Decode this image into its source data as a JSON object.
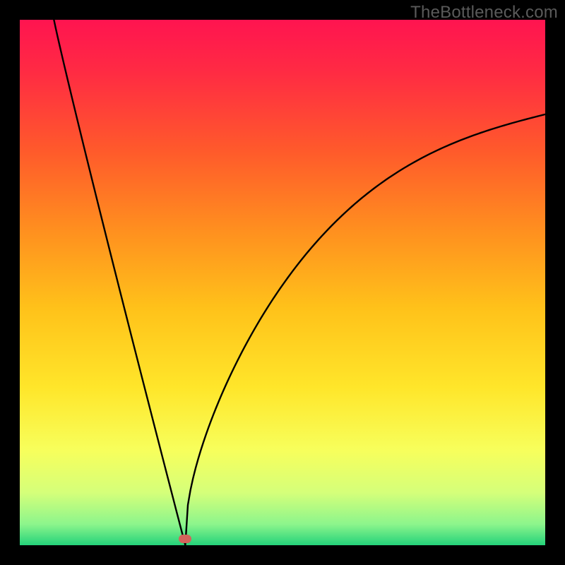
{
  "watermark": "TheBottleneck.com",
  "chart_data": {
    "type": "line",
    "title": "",
    "xlabel": "",
    "ylabel": "",
    "xlim_fraction": [
      0,
      1
    ],
    "ylim_fraction": [
      0,
      1
    ],
    "gradient_stops": [
      {
        "offset": 0.0,
        "color": "#ff1450"
      },
      {
        "offset": 0.1,
        "color": "#ff2b43"
      },
      {
        "offset": 0.25,
        "color": "#ff5a2b"
      },
      {
        "offset": 0.4,
        "color": "#ff8f1f"
      },
      {
        "offset": 0.55,
        "color": "#ffc21a"
      },
      {
        "offset": 0.7,
        "color": "#ffe62a"
      },
      {
        "offset": 0.82,
        "color": "#f7ff5c"
      },
      {
        "offset": 0.9,
        "color": "#d5ff7a"
      },
      {
        "offset": 0.96,
        "color": "#8cf58c"
      },
      {
        "offset": 1.0,
        "color": "#24d27a"
      }
    ],
    "series": [
      {
        "name": "bottleneck-curve",
        "note": "y ≈ |x - minimum.x| shaped curve; left branch very steep, right branch rises asymptotically toward ~0.82",
        "minimum_x_fraction": 0.315,
        "minimum_y_fraction": 0.0,
        "left_branch_top_x_fraction": 0.065,
        "left_branch_top_y_fraction": 1.0,
        "right_branch_end_x_fraction": 1.0,
        "right_branch_end_y_fraction": 0.82
      }
    ],
    "marker": {
      "x_fraction": 0.315,
      "y_from_bottom_fraction": 0.012,
      "color": "#d4635b"
    }
  }
}
